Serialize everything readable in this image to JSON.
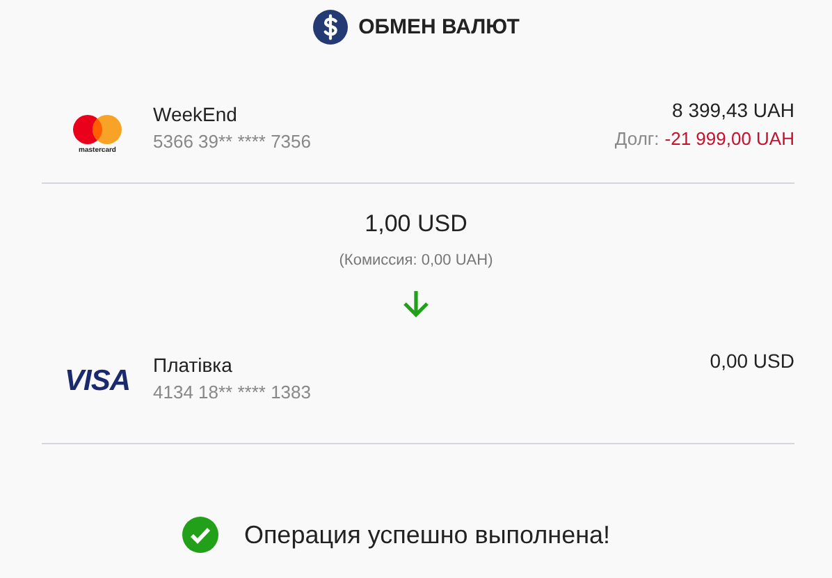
{
  "header": {
    "title": "ОБМЕН ВАЛЮТ"
  },
  "source": {
    "kind": "mastercard",
    "logo_text": "mastercard",
    "name": "WeekEnd",
    "number": "5366 39** **** 7356",
    "balance": "8 399,43 UAH",
    "debt_label": "Долг:",
    "debt": "-21 999,00 UAH"
  },
  "transfer": {
    "amount": "1,00 USD",
    "commission": "(Комиссия: 0,00 UAH)"
  },
  "target": {
    "kind": "visa",
    "logo_text": "VISA",
    "name": "Платівка",
    "number": "4134 18** **** 1383",
    "balance": "0,00 USD"
  },
  "status": {
    "kind": "success",
    "message": "Операция успешно выполнена!"
  }
}
